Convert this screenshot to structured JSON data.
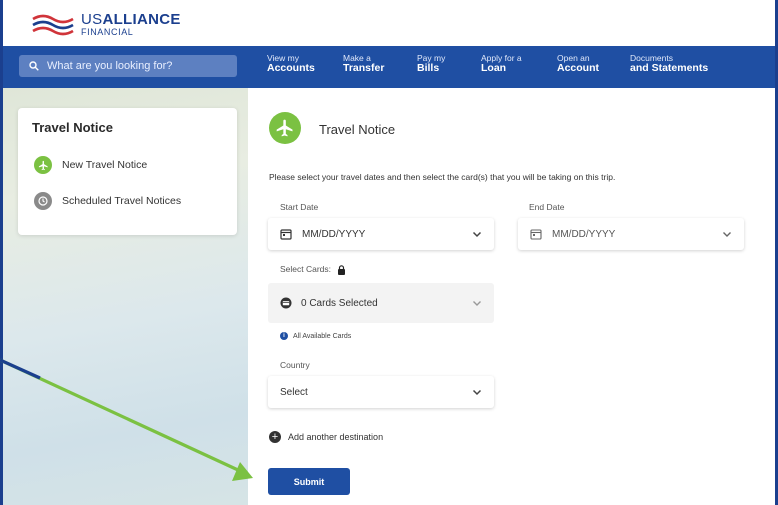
{
  "brand": {
    "line1_us": "US",
    "line1_rest": "ALLIANCE",
    "line2": "FINANCIAL",
    "colors": {
      "primary": "#1f4fa3",
      "accent_green": "#7bc142",
      "stripe_red": "#d0343a"
    }
  },
  "search": {
    "placeholder": "What are you looking for?"
  },
  "nav": [
    {
      "small": "View my",
      "big": "Accounts"
    },
    {
      "small": "Make a",
      "big": "Transfer"
    },
    {
      "small": "Pay my",
      "big": "Bills"
    },
    {
      "small": "Apply for a",
      "big": "Loan"
    },
    {
      "small": "Open an",
      "big": "Account"
    },
    {
      "small": "Documents",
      "big": "and Statements"
    }
  ],
  "sidebar": {
    "title": "Travel Notice",
    "items": [
      {
        "label": "New Travel Notice",
        "icon": "airplane-icon"
      },
      {
        "label": "Scheduled Travel Notices",
        "icon": "clock-icon"
      }
    ]
  },
  "main": {
    "title": "Travel Notice",
    "instructions": "Please select your travel dates and then select the card(s) that you will be taking on this trip.",
    "start_date": {
      "label": "Start Date",
      "placeholder": "MM/DD/YYYY"
    },
    "end_date": {
      "label": "End Date",
      "placeholder": "MM/DD/YYYY"
    },
    "cards": {
      "label": "Select Cards:",
      "value": "0 Cards Selected",
      "info": "All Available Cards"
    },
    "country": {
      "label": "Country",
      "value": "Select"
    },
    "add_destination": "Add another destination",
    "submit": "Submit"
  }
}
